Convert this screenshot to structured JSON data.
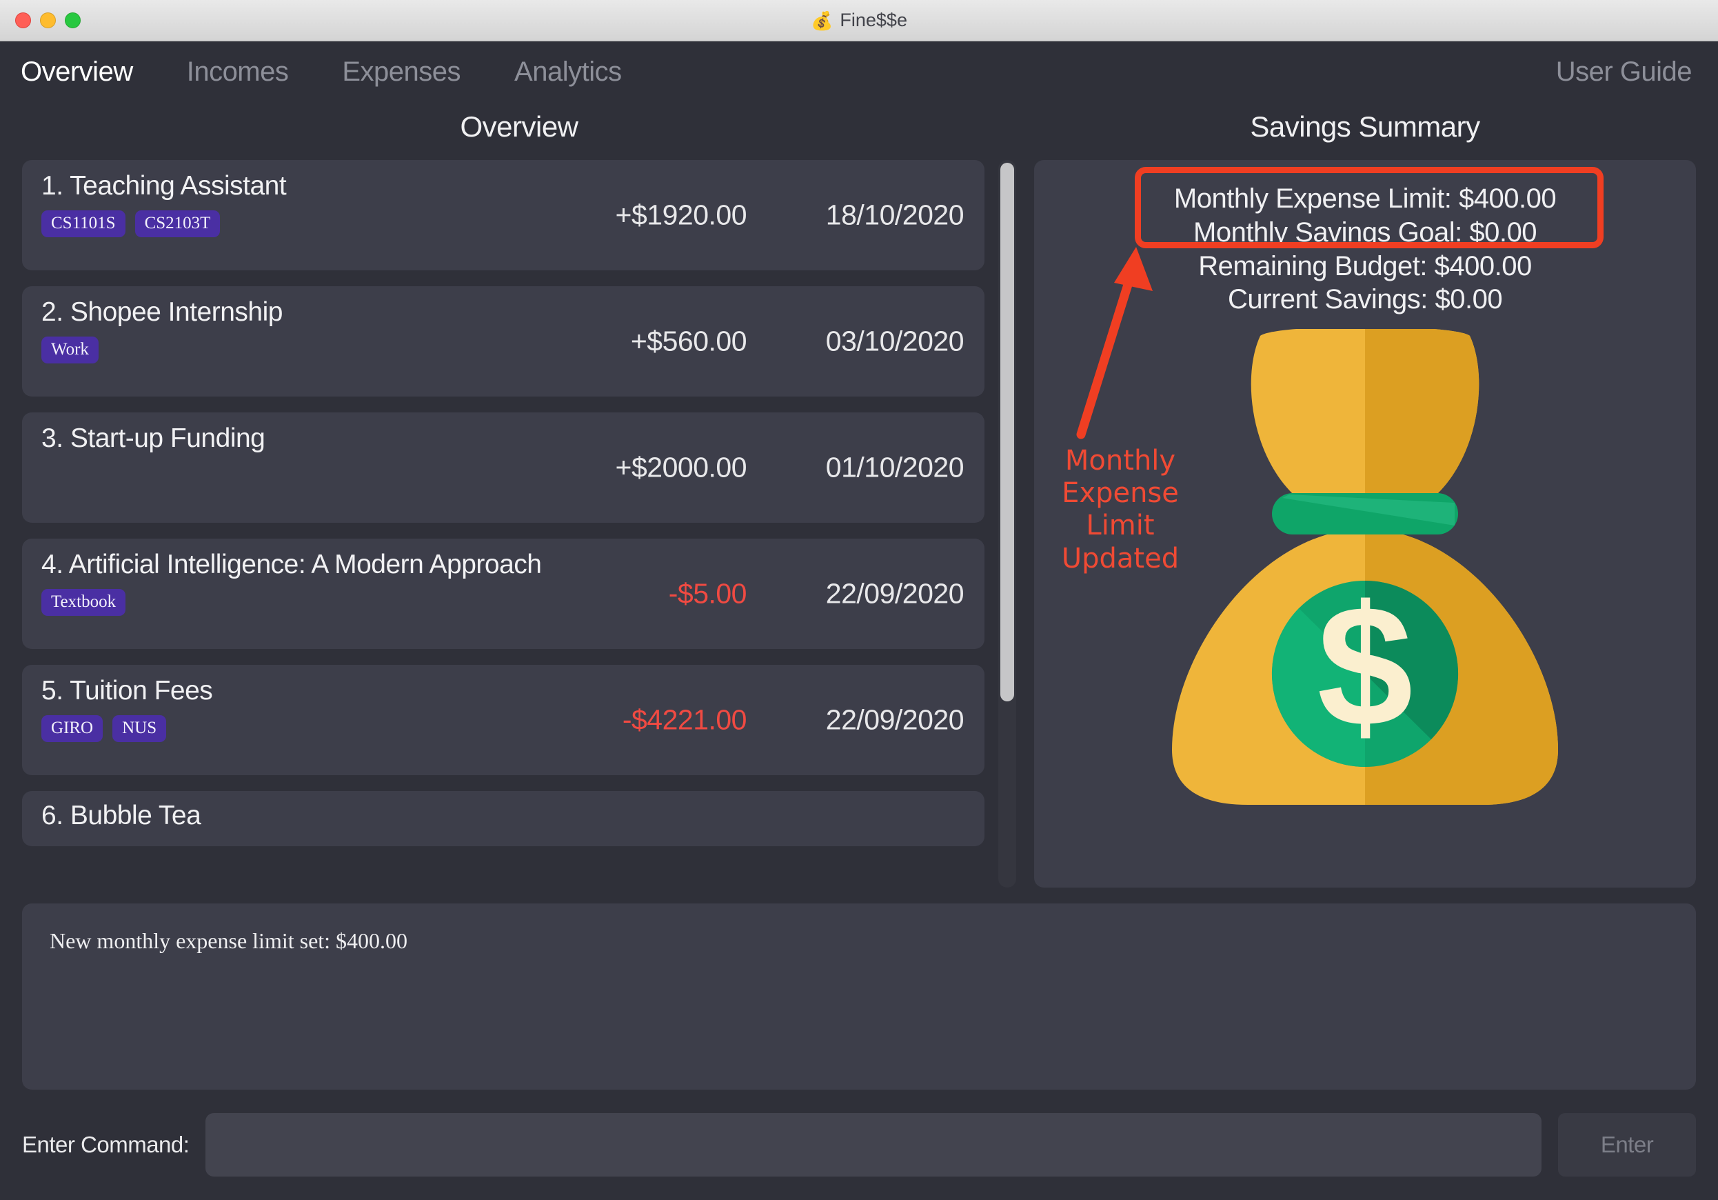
{
  "window": {
    "title": "Fine$$e",
    "title_icon": "money-bag-icon",
    "controls": {
      "close": "close",
      "minimize": "minimize",
      "zoom": "zoom"
    }
  },
  "menubar": {
    "tabs": [
      {
        "label": "Overview",
        "active": true
      },
      {
        "label": "Incomes",
        "active": false
      },
      {
        "label": "Expenses",
        "active": false
      },
      {
        "label": "Analytics",
        "active": false
      }
    ],
    "user_guide": "User Guide"
  },
  "overview": {
    "title": "Overview",
    "transactions": [
      {
        "name": "1. Teaching Assistant",
        "tags": [
          "CS1101S",
          "CS2103T"
        ],
        "amount": "+$1920.00",
        "date": "18/10/2020",
        "negative": false
      },
      {
        "name": "2. Shopee Internship",
        "tags": [
          "Work"
        ],
        "amount": "+$560.00",
        "date": "03/10/2020",
        "negative": false
      },
      {
        "name": "3. Start-up Funding",
        "tags": [],
        "amount": "+$2000.00",
        "date": "01/10/2020",
        "negative": false
      },
      {
        "name": "4. Artificial Intelligence: A Modern Approach",
        "tags": [
          "Textbook"
        ],
        "amount": "-$5.00",
        "date": "22/09/2020",
        "negative": true
      },
      {
        "name": "5. Tuition Fees",
        "tags": [
          "GIRO",
          "NUS"
        ],
        "amount": "-$4221.00",
        "date": "22/09/2020",
        "negative": true
      },
      {
        "name": "6. Bubble Tea",
        "tags": [],
        "amount": "",
        "date": "",
        "negative": false
      }
    ]
  },
  "savings": {
    "title": "Savings Summary",
    "lines": [
      {
        "label": "Monthly Expense Limit: $400.00",
        "highlighted": true
      },
      {
        "label": "Monthly Savings Goal: $0.00",
        "highlighted": false
      },
      {
        "label": "Remaining Budget: $400.00",
        "highlighted": false
      },
      {
        "label": "Current Savings: $0.00",
        "highlighted": false
      }
    ],
    "illustration": "money-bag-illustration"
  },
  "annotation": {
    "text": "Monthly Expense Limit Updated",
    "color": "#f03e22",
    "shape": "rounded-rectangle-with-arrow"
  },
  "result": {
    "text": "New monthly expense limit set: $400.00"
  },
  "command": {
    "label": "Enter Command:",
    "value": "",
    "placeholder": "",
    "button": "Enter"
  },
  "colors": {
    "window_bg": "#2f3039",
    "card_bg": "#3d3e4a",
    "tag_purple": "#4a2fa3",
    "negative_red": "#f04a42",
    "annotation_red": "#f03e22",
    "bag_yellow": "#edb033",
    "bag_green": "#0ea56c"
  }
}
